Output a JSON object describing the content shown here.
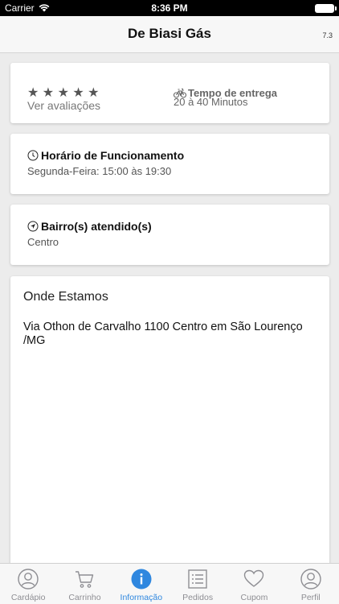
{
  "status_bar": {
    "carrier": "Carrier",
    "time": "8:36 PM"
  },
  "nav": {
    "title": "De Biasi Gás",
    "version": "7.3"
  },
  "rating": {
    "stars": "★ ★ ★ ★ ★",
    "link": "Ver avaliações"
  },
  "delivery": {
    "title": "Tempo de entrega",
    "time": "20 à 40 Minutos"
  },
  "hours": {
    "title": "Horário de Funcionamento",
    "detail": "Segunda-Feira: 15:00 às 19:30"
  },
  "neighborhoods": {
    "title": "Bairro(s) atendido(s)",
    "detail": "Centro"
  },
  "location": {
    "title": "Onde Estamos",
    "address": "Via Othon de Carvalho 1100 Centro em São Lourenço /MG"
  },
  "tabs": [
    {
      "label": "Cardápio",
      "icon": "user-icon"
    },
    {
      "label": "Carrinho",
      "icon": "cart-icon"
    },
    {
      "label": "Informação",
      "icon": "info-icon",
      "active": true
    },
    {
      "label": "Pedidos",
      "icon": "list-icon"
    },
    {
      "label": "Cupom",
      "icon": "heart-icon"
    },
    {
      "label": "Perfil",
      "icon": "profile-icon"
    }
  ],
  "colors": {
    "accent": "#2f87df",
    "inactive": "#8e8e93",
    "background": "#ececec"
  }
}
